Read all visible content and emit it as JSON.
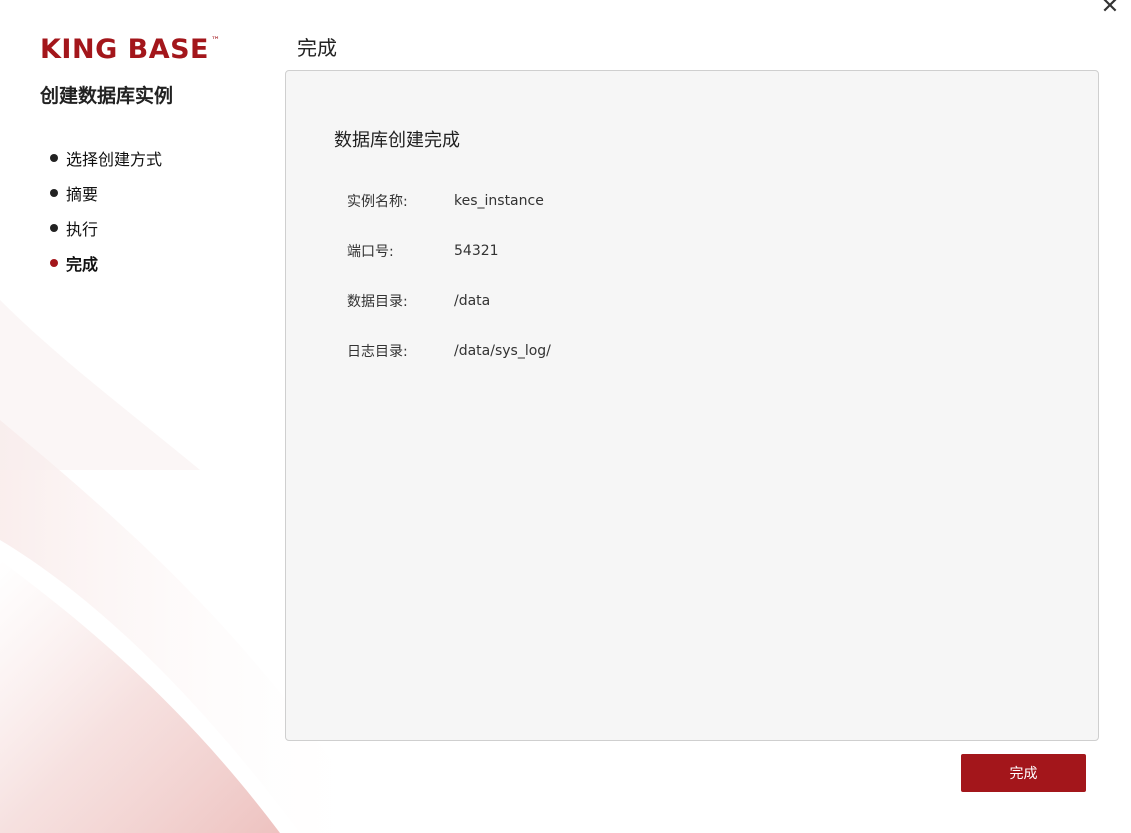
{
  "window": {
    "close_symbol": "✕"
  },
  "brand": {
    "logo_text": "KING BASE",
    "trademark": "™",
    "color": "#a3161b"
  },
  "sidebar": {
    "title": "创建数据库实例",
    "steps": [
      {
        "label": "选择创建方式",
        "active": false
      },
      {
        "label": "摘要",
        "active": false
      },
      {
        "label": "执行",
        "active": false
      },
      {
        "label": "完成",
        "active": true
      }
    ]
  },
  "main": {
    "title": "完成",
    "heading": "数据库创建完成",
    "info": [
      {
        "label": "实例名称:",
        "value": "kes_instance"
      },
      {
        "label": "端口号:",
        "value": "54321"
      },
      {
        "label": "数据目录:",
        "value": "/data"
      },
      {
        "label": "日志目录:",
        "value": "/data/sys_log/"
      }
    ]
  },
  "footer": {
    "finish_label": "完成"
  },
  "icons": {
    "close": "close-icon",
    "step_bullet": "bullet-icon"
  }
}
